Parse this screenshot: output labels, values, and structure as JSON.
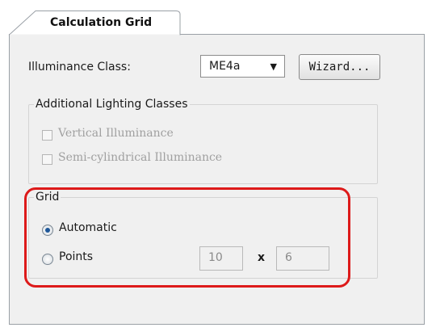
{
  "tab": {
    "label": "Calculation Grid"
  },
  "illuminance": {
    "label": "Illuminance Class:",
    "selected_value": "ME4a",
    "wizard_label": "Wizard..."
  },
  "additional": {
    "legend": "Additional Lighting Classes",
    "vertical_label": "Vertical Illuminance",
    "semicyl_label": "Semi-cylindrical Illuminance",
    "vertical_checked": false,
    "semicyl_checked": false
  },
  "grid": {
    "legend": "Grid",
    "automatic_label": "Automatic",
    "points_label": "Points",
    "selected": "Automatic",
    "points_x": "10",
    "separator": "x",
    "points_y": "6"
  },
  "colors": {
    "highlight": "#dd1a1a",
    "radio_dot": "#1e5799"
  }
}
